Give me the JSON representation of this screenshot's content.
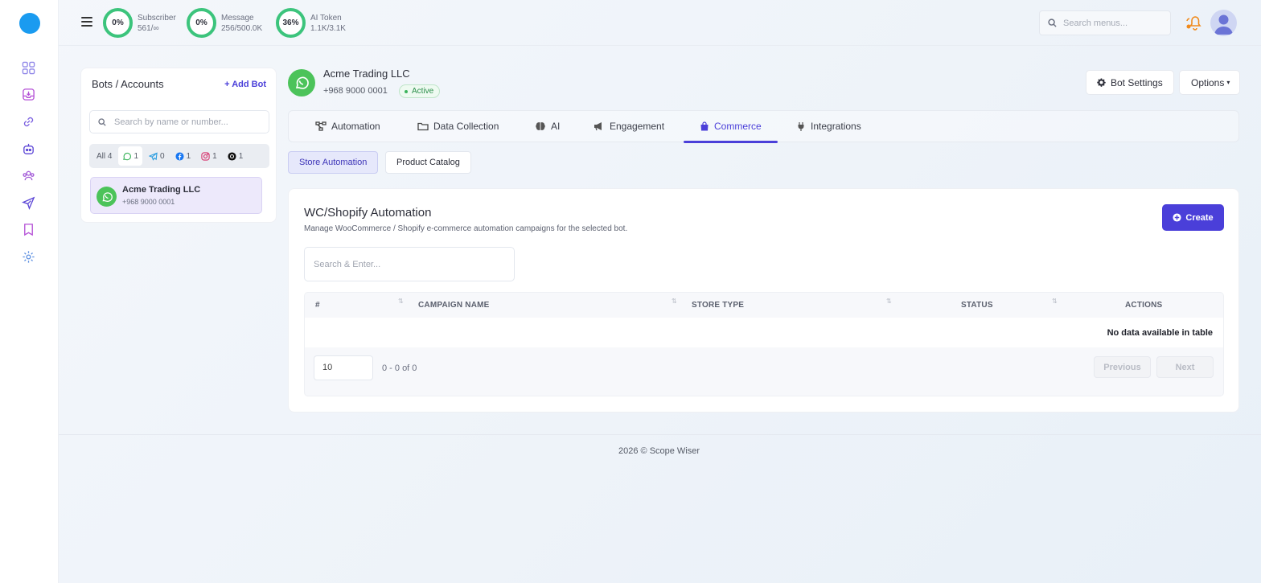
{
  "colors": {
    "accent": "#4a3fd9",
    "whatsapp": "#4cc35a",
    "success": "#3cc47c",
    "logo": "#1a9bf0"
  },
  "sidebar": {
    "icons": [
      "dashboard-icon",
      "inbox-icon",
      "link-icon",
      "bot-icon",
      "users-icon",
      "send-icon",
      "bookmark-icon",
      "settings-icon"
    ]
  },
  "header": {
    "stats": [
      {
        "percent": "0%",
        "label": "Subscriber",
        "value": "561/∞"
      },
      {
        "percent": "0%",
        "label": "Message",
        "value": "256/500.0K"
      },
      {
        "percent": "36%",
        "label": "AI Token",
        "value": "1.1K/3.1K"
      }
    ],
    "search_placeholder": "Search menus..."
  },
  "bots_panel": {
    "title": "Bots / Accounts",
    "add_label": "Add Bot",
    "search_placeholder": "Search by name or number...",
    "filters": [
      {
        "label": "All",
        "count": "4"
      },
      {
        "icon": "whatsapp-icon",
        "count": "1"
      },
      {
        "icon": "telegram-icon",
        "count": "0"
      },
      {
        "icon": "facebook-icon",
        "count": "1"
      },
      {
        "icon": "instagram-icon",
        "count": "1"
      },
      {
        "icon": "threads-icon",
        "count": "1"
      }
    ],
    "bots": [
      {
        "name": "Acme Trading LLC",
        "number": "+968 9000 0001"
      }
    ]
  },
  "bot_header": {
    "name": "Acme Trading LLC",
    "number": "+968 9000 0001",
    "status": "Active",
    "settings_label": "Bot Settings",
    "options_label": "Options"
  },
  "tabs": [
    {
      "label": "Automation",
      "icon": "flow-icon"
    },
    {
      "label": "Data Collection",
      "icon": "folder-icon"
    },
    {
      "label": "AI",
      "icon": "brain-icon"
    },
    {
      "label": "Engagement",
      "icon": "megaphone-icon"
    },
    {
      "label": "Commerce",
      "icon": "bag-icon",
      "active": true
    },
    {
      "label": "Integrations",
      "icon": "plug-icon"
    }
  ],
  "subtabs": [
    {
      "label": "Store Automation",
      "active": true
    },
    {
      "label": "Product Catalog"
    }
  ],
  "card": {
    "title": "WC/Shopify Automation",
    "description": "Manage WooCommerce / Shopify e-commerce automation campaigns for the selected bot.",
    "create_label": "Create",
    "search_placeholder": "Search & Enter...",
    "columns": [
      "#",
      "CAMPAIGN NAME",
      "STORE TYPE",
      "STATUS",
      "ACTIONS"
    ],
    "empty_text": "No data available in table",
    "page_size": "10",
    "page_info": "0 - 0 of 0",
    "prev_label": "Previous",
    "next_label": "Next"
  },
  "footer": {
    "text": "2026 © Scope Wiser"
  }
}
